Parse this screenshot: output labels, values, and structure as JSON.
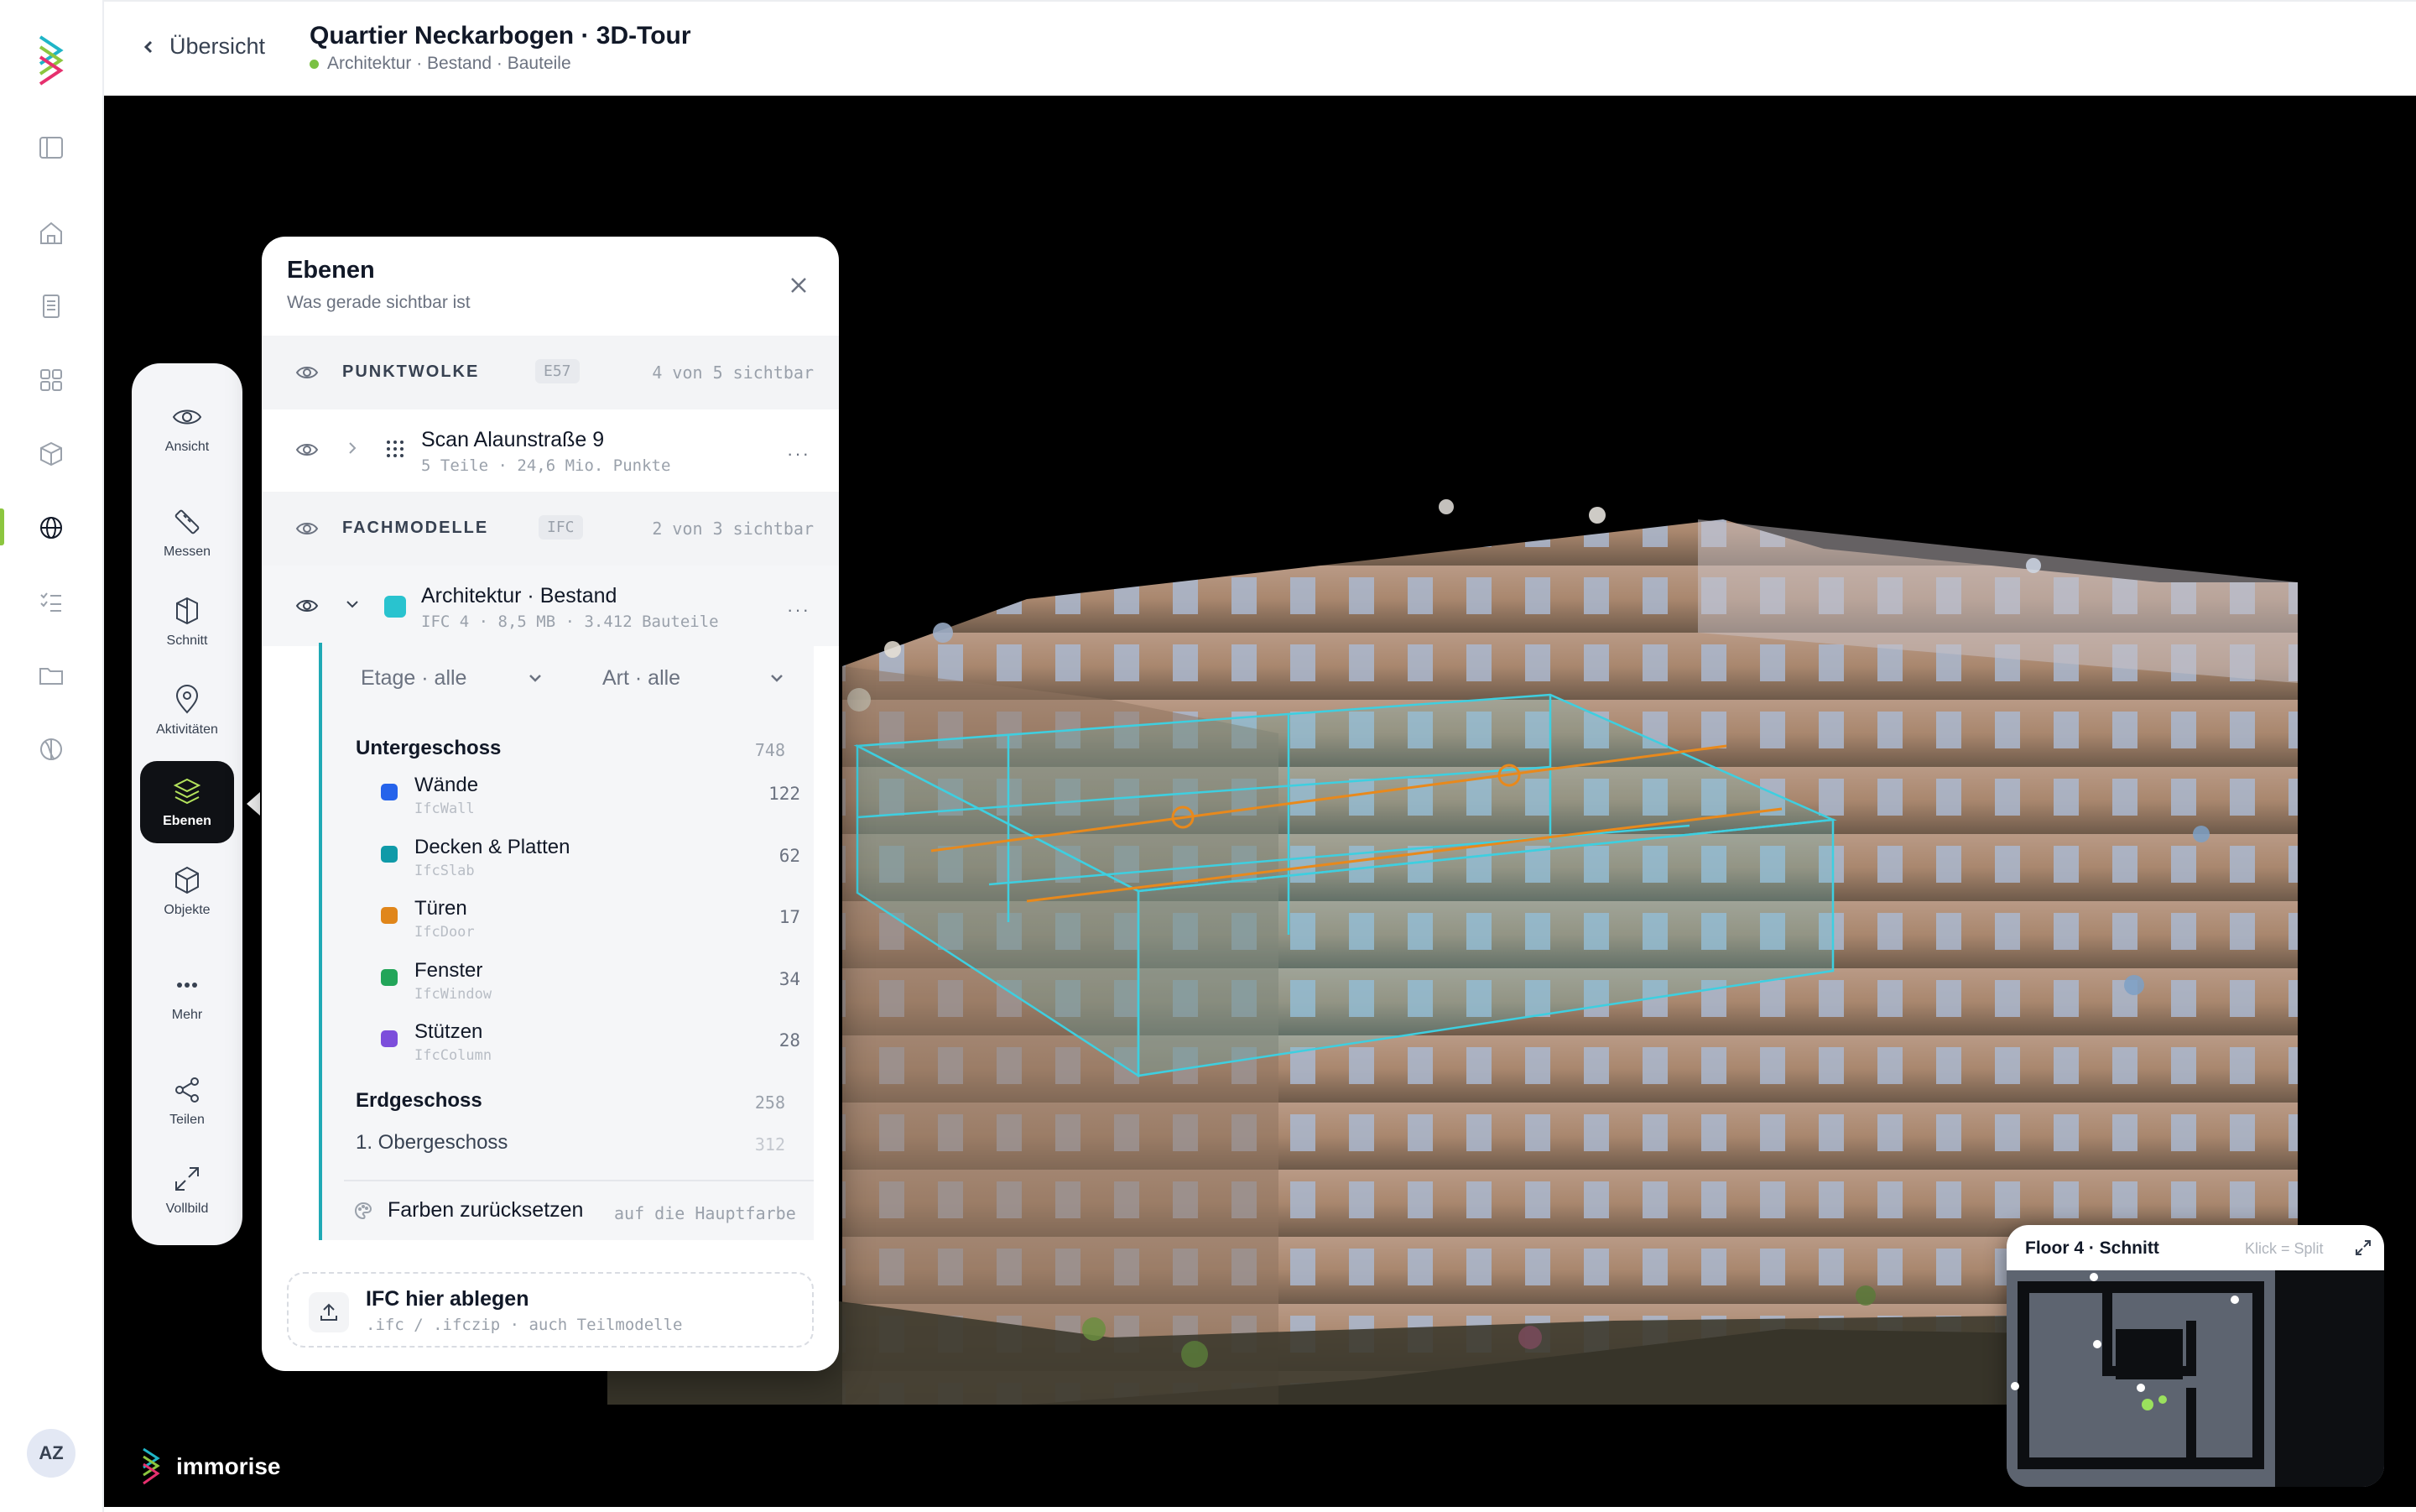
{
  "header": {
    "back_label": "Übersicht",
    "title": "Quartier Neckarbogen · 3D-Tour",
    "subtitle": "Architektur · Bestand · Bauteile"
  },
  "rail": {
    "avatar": "AZ",
    "items": [
      "sidebar-toggle",
      "home",
      "document",
      "dashboard",
      "objects",
      "globe",
      "tasks",
      "folder",
      "planet"
    ],
    "active": "globe",
    "accent": "#8cc63f"
  },
  "brand": {
    "name": "immorise"
  },
  "tools": {
    "items": [
      {
        "label": "Ansicht",
        "icon": "eye-icon"
      },
      {
        "label": "Messen",
        "icon": "ruler-icon"
      },
      {
        "label": "Schnitt",
        "icon": "section-icon"
      },
      {
        "label": "Aktivitäten",
        "icon": "pin-icon"
      },
      {
        "label": "Ebenen",
        "icon": "layers-icon"
      },
      {
        "label": "Objekte",
        "icon": "cube-icon"
      },
      {
        "label": "Mehr",
        "icon": "more-icon"
      },
      {
        "label": "Teilen",
        "icon": "share-icon"
      },
      {
        "label": "Vollbild",
        "icon": "fullscreen-icon"
      }
    ],
    "active": "Ebenen"
  },
  "panel": {
    "title": "Ebenen",
    "subtitle": "Was gerade sichtbar ist",
    "pointcloud": {
      "section": "PUNKTWOLKE",
      "tag": "E57",
      "count": "4 von 5 sichtbar",
      "item_name": "Scan Alaunstraße 9",
      "item_meta": "5 Teile · 24,6 Mio. Punkte"
    },
    "models": {
      "section": "FACHMODELLE",
      "tag": "IFC",
      "count": "2 von 3 sichtbar",
      "item_name": "Architektur · Bestand",
      "item_meta": "IFC 4 · 8,5 MB · 3.412 Bauteile",
      "swatch": "#29c3cf"
    },
    "filters": {
      "floor": "Etage · alle",
      "type": "Art · alle"
    },
    "floors": [
      {
        "name": "Untergeschoss",
        "count": "748"
      },
      {
        "name": "Erdgeschoss",
        "count": "258"
      },
      {
        "name": "1. Obergeschoss",
        "count": "312"
      }
    ],
    "categories": [
      {
        "name": "Wände",
        "ifc": "IfcWall",
        "count": "122",
        "color": "#2563eb"
      },
      {
        "name": "Decken & Platten",
        "ifc": "IfcSlab",
        "count": "62",
        "color": "#0f9aa8"
      },
      {
        "name": "Türen",
        "ifc": "IfcDoor",
        "count": "17",
        "color": "#e0861a"
      },
      {
        "name": "Fenster",
        "ifc": "IfcWindow",
        "count": "34",
        "color": "#22a559"
      },
      {
        "name": "Stützen",
        "ifc": "IfcColumn",
        "count": "28",
        "color": "#7c4ddb"
      }
    ],
    "reset_label": "Farben zurücksetzen",
    "reset_hint": "auf die Hauptfarbe",
    "drop_title": "IFC hier ablegen",
    "drop_hint": ".ifc / .ifczip · auch Teilmodelle"
  },
  "minimap": {
    "title": "Floor 4 · Schnitt",
    "hint": "Klick = Split"
  }
}
